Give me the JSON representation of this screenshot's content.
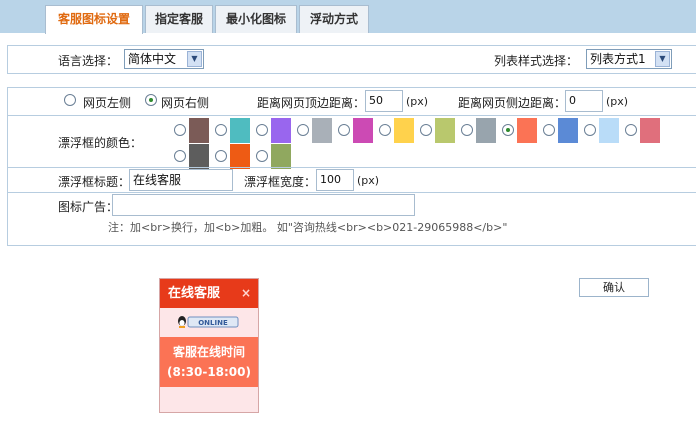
{
  "tabs": [
    {
      "label": "客服图标设置"
    },
    {
      "label": "指定客服"
    },
    {
      "label": "最小化图标"
    },
    {
      "label": "浮动方式"
    }
  ],
  "settings": {
    "language_label": "语言选择：",
    "language_value": "简体中文",
    "list_style_label": "列表样式选择：",
    "list_style_value": "列表方式1",
    "position_left_label": "网页左侧",
    "position_right_label": "网页右侧",
    "position_selected": "网页右侧",
    "top_distance_label": "距离网页顶边距离：",
    "top_distance_value": "50",
    "top_distance_unit": "(px)",
    "side_distance_label": "距离网页侧边距离：",
    "side_distance_value": "0",
    "side_distance_unit": "(px)",
    "color_label": "漂浮框的颜色：",
    "colors": [
      "#7b5b57",
      "#4fbcc0",
      "#9966ee",
      "#a9b0b8",
      "#cc4ab4",
      "#ffd24c",
      "#b9c86d",
      "#98a4ad",
      "#fb7355",
      "#5b8ad6",
      "#b9dcf8",
      "#e06f7c",
      "#5d5d5d",
      "#ee5b14",
      "#90a85f"
    ],
    "selected_color": "#fb7355",
    "title_label": "漂浮框标题：",
    "title_value": "在线客服",
    "width_label": "漂浮框宽度：",
    "width_value": "100",
    "width_unit": "(px)",
    "ad_label": "图标广告：",
    "ad_value": "",
    "note": "注：加<br>换行，加<b>加粗。 如\"咨询热线<br><b>021-29065988</b>\""
  },
  "confirm_button": "确认",
  "preview": {
    "title": "在线客服",
    "close_icon": "×",
    "qq_badge": "ONLINE",
    "hours_line1": "客服在线时间",
    "hours_line2": "(8:30-18:00)"
  },
  "accent_colors": {
    "tab_active_text": "#e06a10",
    "tab_bar": "#b9d4e8",
    "preview_header": "#e73a1a",
    "preview_body": "#fb7355",
    "preview_bg": "#fde6e8"
  }
}
